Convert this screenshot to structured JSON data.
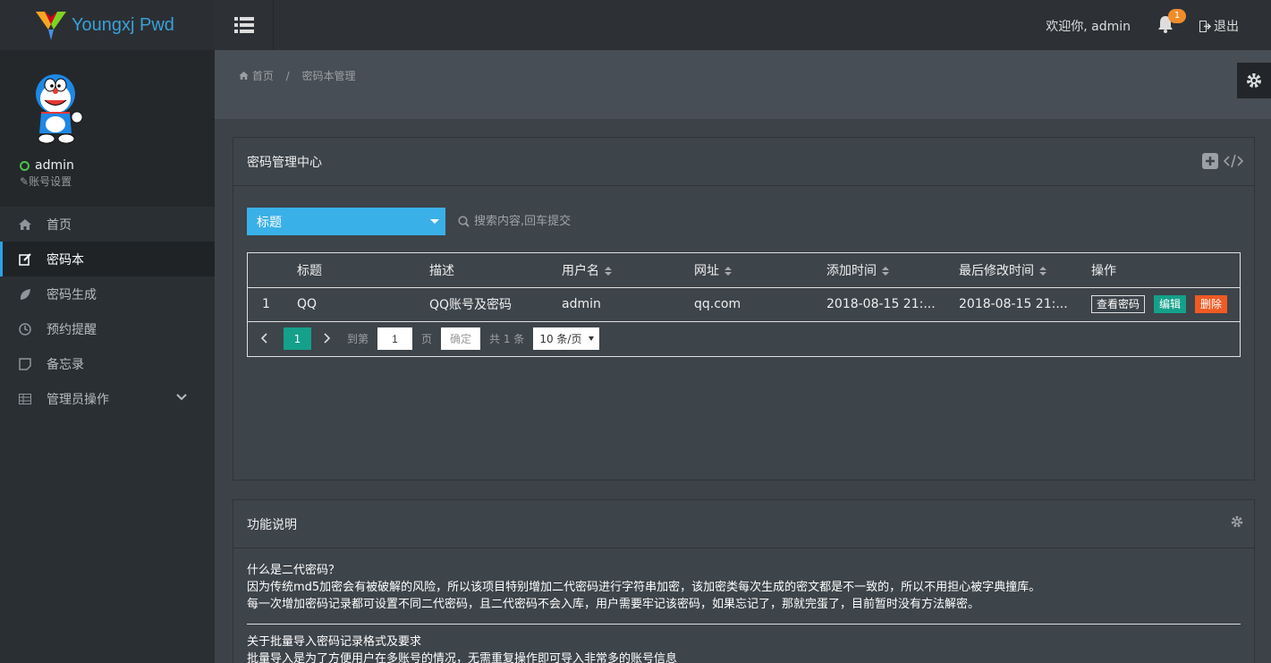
{
  "app": {
    "logo_text": "Youngxj Pwd"
  },
  "header": {
    "welcome": "欢迎你, admin",
    "notification_count": "1",
    "logout": "退出"
  },
  "user": {
    "name": "admin",
    "settings": "账号设置"
  },
  "sidebar": {
    "items": [
      {
        "label": "首页",
        "icon": "home-icon"
      },
      {
        "label": "密码本",
        "icon": "edit-icon"
      },
      {
        "label": "密码生成",
        "icon": "leaf-icon"
      },
      {
        "label": "预约提醒",
        "icon": "clock-icon"
      },
      {
        "label": "备忘录",
        "icon": "note-icon"
      },
      {
        "label": "管理员操作",
        "icon": "table-icon"
      }
    ],
    "active_index": 1
  },
  "breadcrumb": {
    "home": "首页",
    "separator": "/",
    "current": "密码本管理"
  },
  "manager": {
    "title": "密码管理中心",
    "filter_select": "标题",
    "search_placeholder": "搜索内容,回车提交",
    "columns": [
      "",
      "标题",
      "描述",
      "用户名",
      "网址",
      "添加时间",
      "最后修改时间",
      "操作"
    ],
    "rows": [
      {
        "index": "1",
        "title": "QQ",
        "desc": "QQ账号及密码",
        "username": "admin",
        "url": "qq.com",
        "added": "2018-08-15 21:...",
        "modified": "2018-08-15 21:..."
      }
    ],
    "actions": {
      "view": "查看密码",
      "edit": "编辑",
      "delete": "删除"
    },
    "pager": {
      "current": "1",
      "goto": "到第",
      "page_input": "1",
      "page_unit": "页",
      "confirm": "确定",
      "total": "共 1 条",
      "page_size": "10 条/页"
    }
  },
  "info": {
    "title": "功能说明",
    "q1": "什么是二代密码？",
    "p1": "因为传统md5加密会有被破解的风险，所以该项目特别增加二代密码进行字符串加密，该加密类每次生成的密文都是不一致的，所以不用担心被字典撞库。",
    "p2": "每一次增加密码记录都可设置不同二代密码，且二代密码不会入库，用户需要牢记该密码，如果忘记了，那就完蛋了，目前暂时没有方法解密。",
    "q2": "关于批量导入密码记录格式及要求",
    "p3": "批量导入是为了方便用户在多账号的情况，无需重复操作即可导入非常多的账号信息"
  },
  "colors": {
    "accent": "#3ab0e8",
    "teal": "#14a08a",
    "danger": "#f05a23",
    "badge": "#f08c2a"
  }
}
